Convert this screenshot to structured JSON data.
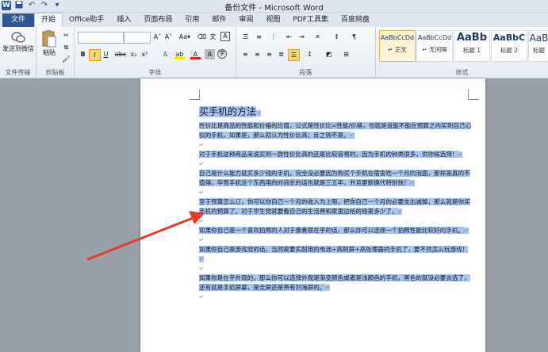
{
  "window": {
    "title": "备份文件 - Microsoft Word",
    "app_icon": "W"
  },
  "qat": {
    "undo": "↶",
    "redo": "↷",
    "more": "▾"
  },
  "tabs": [
    "文件",
    "开始",
    "Office助手",
    "插入",
    "页面布局",
    "引用",
    "邮件",
    "审阅",
    "视图",
    "PDF工具集",
    "百度网盘"
  ],
  "groups": {
    "wechat": {
      "button": "发送到微信",
      "label": "文件传输"
    },
    "clipboard": {
      "paste": "粘贴",
      "label": "剪贴板"
    },
    "font": {
      "label": "字体",
      "grow": "A˄",
      "shrink": "A˅",
      "case": "Aa▾",
      "bold": "B",
      "italic": "I",
      "underline": "U",
      "strike": "abc",
      "sub": "x₂",
      "sup": "x²"
    },
    "paragraph": {
      "label": "段落"
    },
    "styles": {
      "label": "样式",
      "items": [
        {
          "preview": "AaBbCcDd",
          "name": "↵ 正文",
          "selected": true
        },
        {
          "preview": "AaBbCcDd",
          "name": "↵ 无间隔",
          "selected": false
        },
        {
          "preview": "AaBb",
          "name": "标题 1",
          "selected": false
        },
        {
          "preview": "AaBbC",
          "name": "标题 2",
          "selected": false
        },
        {
          "preview": "AaB",
          "name": "标题",
          "selected": false
        }
      ]
    }
  },
  "document": {
    "title": "买手机的方法",
    "paragraphs": [
      "性价比是商品的性能和价格的比值，公式是性价比=性能/价格，也就是说能不能在预算之内买到自己心仪的手机，如果是，那么就认为性价比高；反之则不是。",
      "对于手机这种商品来说买到一款性价比高的还是比较容易的，因为手机的种类很多，供你候选择！",
      "自己是什么能力就买多少钱的手机，完全没必要因为购买个手机在宿舍吃一个月的泡面，那样是真的不值得。毕竟手机这个东西用的时间长的话也就是三五年，并且更新换代特别快！",
      "至于预算怎么订，你可以你自己一个月的收入为上限，把你自己一个月的必要支出减掉，那么就是你买手机的预算了。对于学生党就要看自己的生活费和家里边给的钱是多少了。",
      "如果你自己是一个喜欢拍照的人对于像素很在乎的话，那么你可以选择一个拍照性能比较好的手机。",
      "如果你自己是游戏党的话，当然是要买耐用的电池+高刷屏+高处理器的手机了，要不然怎么玩游戏！",
      "如果你是在乎外观的，那么你可以选择外观是渐变颜色或者是浅颜色的手机，黑色的就没必要去选了，还有就是手机屏幕，是全屏还是带有刘海屏的。"
    ]
  },
  "colors": {
    "accent": "#2b5797",
    "selection": "#a9c4ef",
    "arrow": "#e53b2c"
  }
}
